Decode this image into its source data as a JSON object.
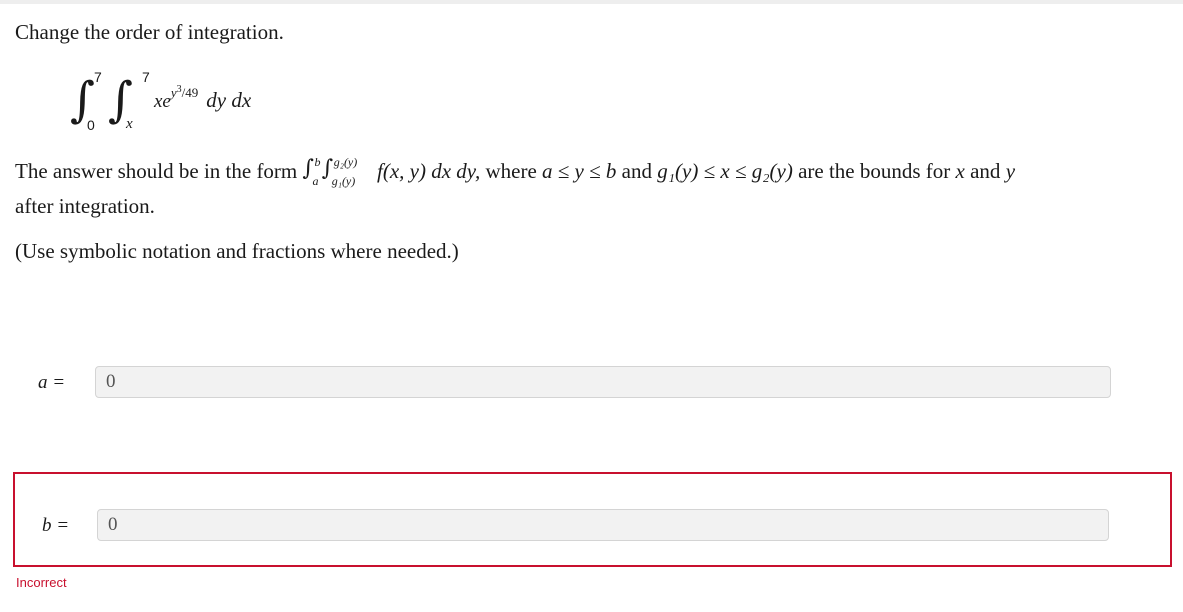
{
  "question": {
    "prompt": "Change the order of integration.",
    "integral": {
      "outer_upper": "7",
      "outer_lower": "0",
      "inner_upper": "7",
      "inner_lower": "x",
      "integrand_base": "xe",
      "integrand_exp_var": "y",
      "integrand_exp_power": "3",
      "integrand_exp_rest": "/49",
      "differentials": "dy dx"
    },
    "form_text_before": "The answer should be in the form",
    "form_int_outer_upper": "b",
    "form_int_outer_lower": "a",
    "form_int_inner_upper": "g₂(y)",
    "form_int_inner_lower": "g₁(y)",
    "form_integrand": "f(x, y) dx dy,",
    "form_where": "where",
    "form_cond_1": "a ≤ y ≤ b",
    "form_and": "and",
    "form_cond_2": "g₁(y) ≤ x ≤ g₂(y)",
    "form_tail_a": "are the bounds for",
    "form_var_x": "x",
    "form_and_2": "and",
    "form_var_y": "y",
    "form_line2": "after integration.",
    "hint": "(Use symbolic notation and fractions where needed.)"
  },
  "answers": {
    "a": {
      "label": "a",
      "equals": "=",
      "value": "0"
    },
    "b": {
      "label": "b",
      "equals": "=",
      "value": "0",
      "status": "Incorrect"
    }
  },
  "colors": {
    "error": "#c8102e",
    "input_bg": "#f2f2f2",
    "input_border": "#d4d4d4"
  }
}
